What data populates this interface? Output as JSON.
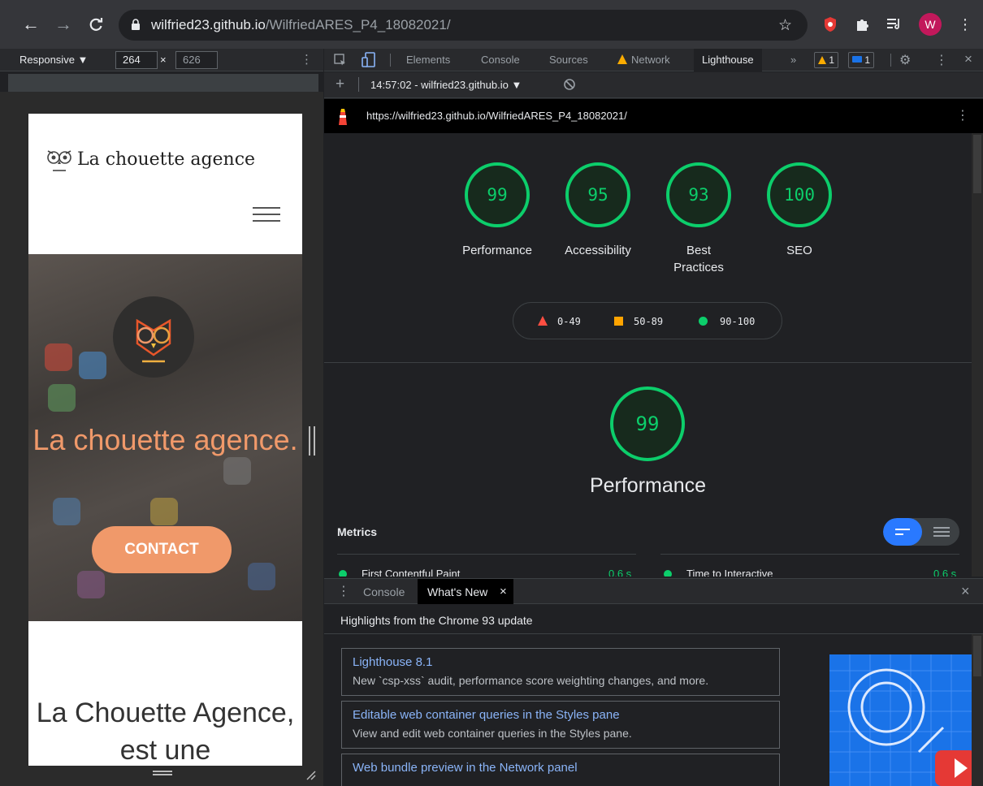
{
  "browser": {
    "url_host": "wilfried23.github.io",
    "url_path": "/WilfriedARES_P4_18082021/",
    "avatar_initial": "W",
    "icons": [
      "back-icon",
      "forward-icon",
      "reload-icon",
      "lock-icon",
      "star-icon",
      "extension-shield-icon",
      "puzzle-icon",
      "reading-list-icon",
      "profile-avatar",
      "more-vert-icon"
    ]
  },
  "device_toolbar": {
    "mode": "Responsive ▼",
    "width": "264",
    "times": "×",
    "height": "626"
  },
  "site": {
    "brand": "La chouette agence",
    "hero_title": "La chouette agence.",
    "contact_label": "CONTACT",
    "intro_text": "La Chouette Agence, est une"
  },
  "devtools": {
    "tabs": [
      "Elements",
      "Console",
      "Sources",
      "Network",
      "Lighthouse"
    ],
    "more_tabs": "»",
    "warnings": "1",
    "messages": "1",
    "report_time": "14:57:02 - wilfried23.github.io ▼",
    "report_url": "https://wilfried23.github.io/WilfriedARES_P4_18082021/"
  },
  "lighthouse": {
    "scores": [
      {
        "value": "99",
        "label": "Performance"
      },
      {
        "value": "95",
        "label": "Accessibility"
      },
      {
        "value": "93",
        "label": "Best Practices"
      },
      {
        "value": "100",
        "label": "SEO"
      }
    ],
    "legend": [
      {
        "range": "0-49",
        "color": "#ff4e42"
      },
      {
        "range": "50-89",
        "color": "#ffa400"
      },
      {
        "range": "90-100",
        "color": "#0cce6b"
      }
    ],
    "perf_score": "99",
    "perf_title": "Performance",
    "metrics_label": "Metrics",
    "metrics": [
      {
        "name": "First Contentful Paint",
        "value": "0.6 s"
      },
      {
        "name": "Time to Interactive",
        "value": "0.6 s"
      }
    ],
    "pass_color": "#0cce6b"
  },
  "drawer": {
    "tabs": [
      "Console",
      "What's New"
    ],
    "close_glyph": "×",
    "subtitle": "Highlights from the Chrome 93 update",
    "news": [
      {
        "title": "Lighthouse 8.1",
        "desc": "New `csp-xss` audit, performance score weighting changes, and more."
      },
      {
        "title": "Editable web container queries in the Styles pane",
        "desc": "View and edit web container queries in the Styles pane."
      },
      {
        "title": "Web bundle preview in the Network panel",
        "desc": ""
      }
    ]
  },
  "colors": {
    "accent_blue": "#1a73e8",
    "hero_orange": "#f0996a",
    "pass_green": "#0cce6b"
  }
}
